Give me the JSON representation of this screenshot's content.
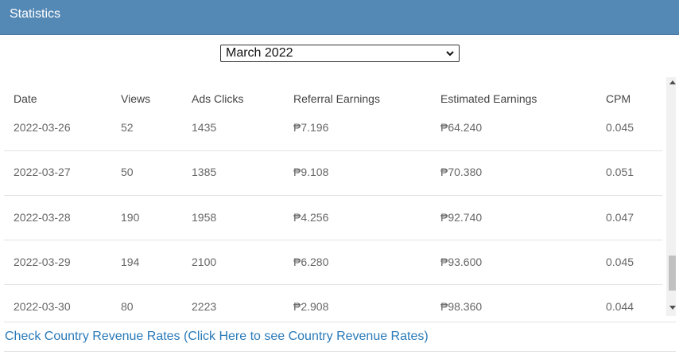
{
  "header": {
    "title": "Statistics"
  },
  "month_select": {
    "selected": "March 2022"
  },
  "table": {
    "columns": [
      "Date",
      "Views",
      "Ads Clicks",
      "Referral Earnings",
      "Estimated Earnings",
      "CPM"
    ],
    "rows": [
      [
        "2022-03-26",
        "52",
        "1435",
        "₱7.196",
        "₱64.240",
        "0.045"
      ],
      [
        "2022-03-27",
        "50",
        "1385",
        "₱9.108",
        "₱70.380",
        "0.051"
      ],
      [
        "2022-03-28",
        "190",
        "1958",
        "₱4.256",
        "₱92.740",
        "0.047"
      ],
      [
        "2022-03-29",
        "194",
        "2100",
        "₱6.280",
        "₱93.600",
        "0.045"
      ],
      [
        "2022-03-30",
        "80",
        "2223",
        "₱2.908",
        "₱98.360",
        "0.044"
      ]
    ]
  },
  "footer": {
    "link_text": "Check Country Revenue Rates (Click Here to see Country Revenue Rates)"
  },
  "colors": {
    "header_bg": "#5589b5",
    "link": "#2a7ab8"
  }
}
